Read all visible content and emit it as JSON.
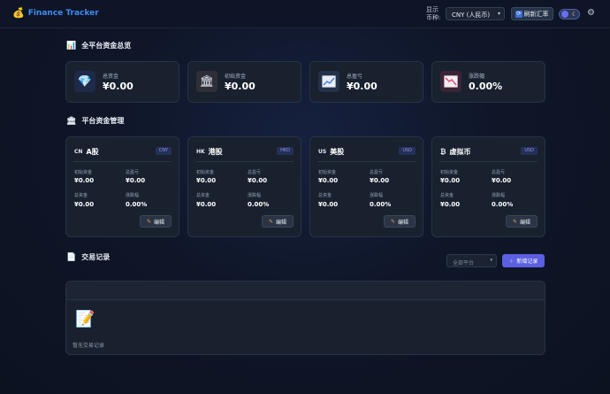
{
  "header": {
    "app_icon": "money-bag-icon",
    "app_title": "Finance Tracker",
    "currency_label": "显示币种:",
    "currency_value": "CNY (人民币)",
    "refresh_label": "刷新汇率",
    "theme_icon": "moon-icon",
    "settings_icon": "gear-icon"
  },
  "overview": {
    "title": "全平台资金总览",
    "title_icon": "bar-chart-icon",
    "cards": [
      {
        "label": "总资金",
        "value": "¥0.00",
        "icon": "gem-icon"
      },
      {
        "label": "初始资金",
        "value": "¥0.00",
        "icon": "bank-icon"
      },
      {
        "label": "总盈亏",
        "value": "¥0.00",
        "icon": "trend-up-icon"
      },
      {
        "label": "涨跌幅",
        "value": "0.00%",
        "icon": "trend-down-icon"
      }
    ]
  },
  "platforms": {
    "title": "平台资金管理",
    "title_icon": "bank-icon",
    "items": [
      {
        "code": "CN",
        "name": "A股",
        "currency": "CNY",
        "initial_label": "初始资金",
        "initial": "¥0.00",
        "pnl_label": "总盈亏",
        "pnl": "¥0.00",
        "total_label": "总资金",
        "total": "¥0.00",
        "change_label": "涨跌幅",
        "change": "0.00%",
        "edit_label": "编辑"
      },
      {
        "code": "HK",
        "name": "港股",
        "currency": "HKD",
        "initial_label": "初始资金",
        "initial": "¥0.00",
        "pnl_label": "总盈亏",
        "pnl": "¥0.00",
        "total_label": "总资金",
        "total": "¥0.00",
        "change_label": "涨跌幅",
        "change": "0.00%",
        "edit_label": "编辑"
      },
      {
        "code": "US",
        "name": "美股",
        "currency": "USD",
        "initial_label": "初始资金",
        "initial": "¥0.00",
        "pnl_label": "总盈亏",
        "pnl": "¥0.00",
        "total_label": "总资金",
        "total": "¥0.00",
        "change_label": "涨跌幅",
        "change": "0.00%",
        "edit_label": "编辑"
      },
      {
        "code": "₿",
        "name": "虚拟币",
        "currency": "USD",
        "initial_label": "初始资金",
        "initial": "¥0.00",
        "pnl_label": "总盈亏",
        "pnl": "¥0.00",
        "total_label": "总资金",
        "total": "¥0.00",
        "change_label": "涨跌幅",
        "change": "0.00%",
        "edit_label": "编辑"
      }
    ]
  },
  "transactions": {
    "title": "交易记录",
    "title_icon": "memo-icon",
    "filter_value": "全部平台",
    "add_label": "新增记录",
    "empty_icon": "memo-icon",
    "empty_text": "暂无交易记录"
  }
}
